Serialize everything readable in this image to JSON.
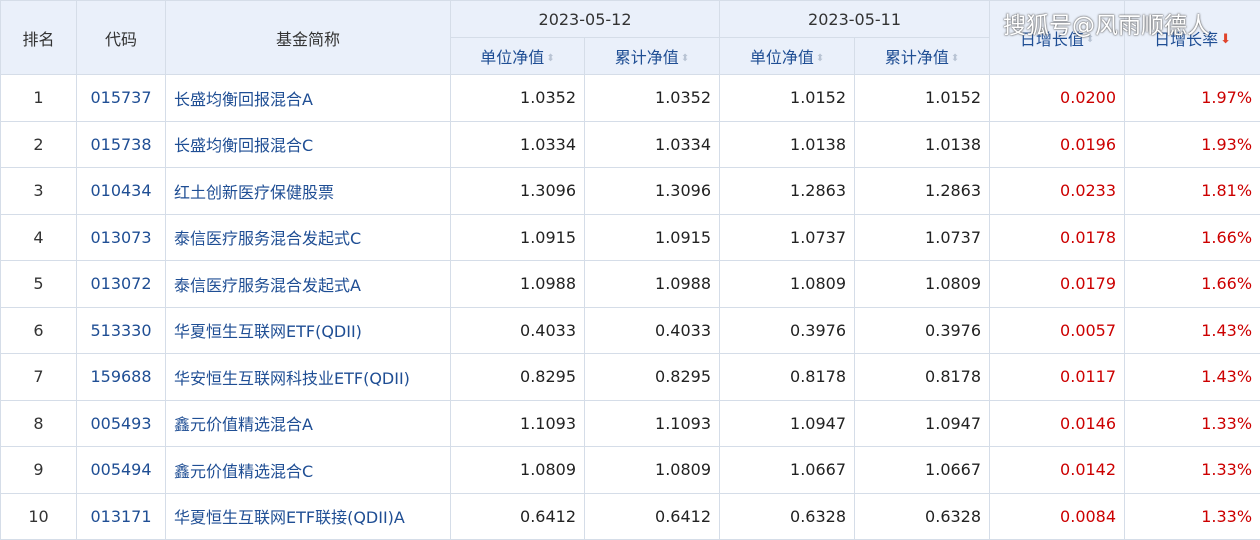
{
  "header": {
    "rank": "排名",
    "code": "代码",
    "name": "基金简称",
    "date1": "2023-05-12",
    "date2": "2023-05-11",
    "unit_nav": "单位净值",
    "cum_nav": "累计净值",
    "daily_growth_value": "日增长值",
    "daily_growth_rate": "日增长率",
    "sort_icon": "sort-arrows",
    "sort_active_icon": "sort-desc-arrow"
  },
  "watermark": "搜狐号@风雨顺德人",
  "rows": [
    {
      "rank": "1",
      "code": "015737",
      "name": "长盛均衡回报混合A",
      "nav1": "1.0352",
      "cum1": "1.0352",
      "nav2": "1.0152",
      "cum2": "1.0152",
      "growth": "0.0200",
      "rate": "1.97%"
    },
    {
      "rank": "2",
      "code": "015738",
      "name": "长盛均衡回报混合C",
      "nav1": "1.0334",
      "cum1": "1.0334",
      "nav2": "1.0138",
      "cum2": "1.0138",
      "growth": "0.0196",
      "rate": "1.93%"
    },
    {
      "rank": "3",
      "code": "010434",
      "name": "红土创新医疗保健股票",
      "nav1": "1.3096",
      "cum1": "1.3096",
      "nav2": "1.2863",
      "cum2": "1.2863",
      "growth": "0.0233",
      "rate": "1.81%"
    },
    {
      "rank": "4",
      "code": "013073",
      "name": "泰信医疗服务混合发起式C",
      "nav1": "1.0915",
      "cum1": "1.0915",
      "nav2": "1.0737",
      "cum2": "1.0737",
      "growth": "0.0178",
      "rate": "1.66%"
    },
    {
      "rank": "5",
      "code": "013072",
      "name": "泰信医疗服务混合发起式A",
      "nav1": "1.0988",
      "cum1": "1.0988",
      "nav2": "1.0809",
      "cum2": "1.0809",
      "growth": "0.0179",
      "rate": "1.66%"
    },
    {
      "rank": "6",
      "code": "513330",
      "name": "华夏恒生互联网ETF(QDII)",
      "nav1": "0.4033",
      "cum1": "0.4033",
      "nav2": "0.3976",
      "cum2": "0.3976",
      "growth": "0.0057",
      "rate": "1.43%"
    },
    {
      "rank": "7",
      "code": "159688",
      "name": "华安恒生互联网科技业ETF(QDII)",
      "nav1": "0.8295",
      "cum1": "0.8295",
      "nav2": "0.8178",
      "cum2": "0.8178",
      "growth": "0.0117",
      "rate": "1.43%"
    },
    {
      "rank": "8",
      "code": "005493",
      "name": "鑫元价值精选混合A",
      "nav1": "1.1093",
      "cum1": "1.1093",
      "nav2": "1.0947",
      "cum2": "1.0947",
      "growth": "0.0146",
      "rate": "1.33%"
    },
    {
      "rank": "9",
      "code": "005494",
      "name": "鑫元价值精选混合C",
      "nav1": "1.0809",
      "cum1": "1.0809",
      "nav2": "1.0667",
      "cum2": "1.0667",
      "growth": "0.0142",
      "rate": "1.33%"
    },
    {
      "rank": "10",
      "code": "013171",
      "name": "华夏恒生互联网ETF联接(QDII)A",
      "nav1": "0.6412",
      "cum1": "0.6412",
      "nav2": "0.6328",
      "cum2": "0.6328",
      "growth": "0.0084",
      "rate": "1.33%"
    }
  ]
}
